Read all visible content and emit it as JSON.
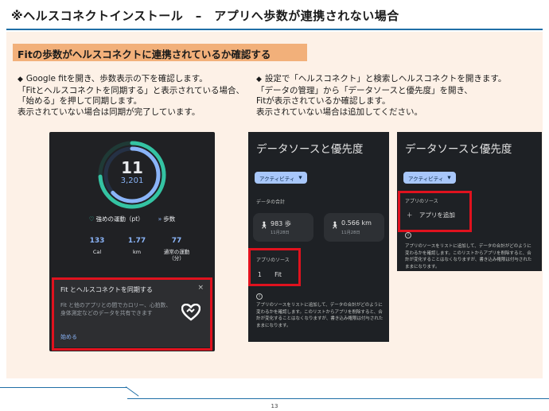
{
  "slide": {
    "title": "※ヘルスコネクトインストール　–　アプリへ歩数が連携されない場合",
    "section_label": "Fitの歩数がヘルスコネクトに連携されているか確認する",
    "page_number": "13"
  },
  "left_text": {
    "line1": "Google fitを開き、歩数表示の下を確認します。",
    "line2": "「Fitとヘルスコネクトを同期する」と表示されている場合、",
    "line3": "「始める」を押して同期します。",
    "line4": "表示されていない場合は同期が完了しています。"
  },
  "right_text": {
    "line1": "設定で「ヘルスコネクト」と検索しヘルスコネクトを開きます。",
    "line2": "「データの管理」から「データソースと優先度」を開き、",
    "line3": "Fitが表示されているか確認します。",
    "line4": "表示されていない場合は追加してください。"
  },
  "fit_screen": {
    "ring_big": "11",
    "ring_small": "3,201",
    "heart_points_progress": 0.74,
    "steps_progress": 0.63,
    "legend_heart": "強めの運動（pt）",
    "legend_steps": "歩数",
    "stats": [
      {
        "value": "133",
        "label": "Cal"
      },
      {
        "value": "1.77",
        "label": "km"
      },
      {
        "value": "77",
        "label": "通常の運動（分）"
      }
    ],
    "sync_card": {
      "title": "Fit とヘルスコネクトを同期する",
      "close": "×",
      "body": "Fit と他のアプリとの間でカロリー、心拍数、身体測定などのデータを共有できます",
      "start": "始める"
    },
    "colors": {
      "heart": "#34c3a3",
      "steps": "#8ab4f8"
    }
  },
  "data_source_screen": {
    "title": "データソースと優先度",
    "chip": "アクティビティ",
    "total_label": "データの合計",
    "tiles": [
      {
        "icon": "walk-icon",
        "value": "983 歩",
        "date": "11月28日"
      },
      {
        "icon": "walk-icon",
        "value": "0.566 km",
        "date": "11月28日"
      }
    ],
    "sources_label": "アプリのソース",
    "app_index": "1",
    "app_name": "Fit",
    "info_text": "アプリのソースをリストに追加して、データの合計がどのように変わるかを確認します。このリストからアプリを削除すると、合計が変化することはなくなりますが、書き込み権限は付与されたままになります。"
  },
  "data_source_screen_empty": {
    "title": "データソースと優先度",
    "chip": "アクティビティ",
    "sources_label": "アプリのソース",
    "add_app": "アプリを追加",
    "info_text": "アプリのソースをリストに追加して、データの合計がどのように変わるかを確認します。このリストからアプリを削除すると、合計が変化することはなくなりますが、書き込み権限は付与されたままになります。"
  },
  "colors": {
    "highlight": "#e0121e",
    "section_bg": "#f2b07a",
    "content_bg": "#fdf1e7",
    "rule": "#1f6fa6"
  }
}
